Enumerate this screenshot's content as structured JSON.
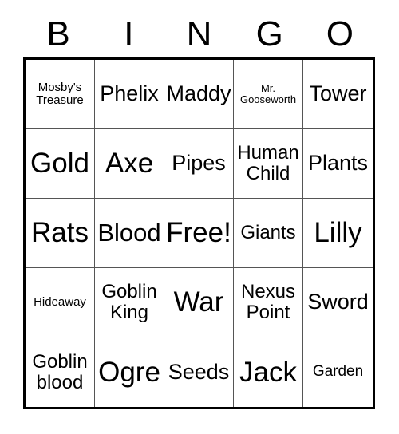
{
  "card": {
    "title": "BINGO",
    "header_letters": [
      "B",
      "I",
      "N",
      "G",
      "O"
    ],
    "free_space": "Free!",
    "colors": {
      "background": "#ffffff",
      "text": "#000000",
      "outer_border": "#000000",
      "grid_line": "#555555"
    },
    "grid": {
      "columns": 5,
      "rows": 5,
      "cells": [
        [
          {
            "label": "Mosby's Treasure",
            "size": "xs"
          },
          {
            "label": "Phelix",
            "size": "lg"
          },
          {
            "label": "Maddy",
            "size": "lg"
          },
          {
            "label": "Mr. Gooseworth",
            "size": "xxs"
          },
          {
            "label": "Tower",
            "size": "lg"
          }
        ],
        [
          {
            "label": "Gold",
            "size": "xxl"
          },
          {
            "label": "Axe",
            "size": "xxl"
          },
          {
            "label": "Pipes",
            "size": "lg"
          },
          {
            "label": "Human Child",
            "size": "md"
          },
          {
            "label": "Plants",
            "size": "lg"
          }
        ],
        [
          {
            "label": "Rats",
            "size": "xxl"
          },
          {
            "label": "Blood",
            "size": "xl"
          },
          {
            "label": "Free!",
            "size": "xxl"
          },
          {
            "label": "Giants",
            "size": "md"
          },
          {
            "label": "Lilly",
            "size": "xxl"
          }
        ],
        [
          {
            "label": "Hideaway",
            "size": "xs"
          },
          {
            "label": "Goblin King",
            "size": "md"
          },
          {
            "label": "War",
            "size": "xxl"
          },
          {
            "label": "Nexus Point",
            "size": "md"
          },
          {
            "label": "Sword",
            "size": "lg"
          }
        ],
        [
          {
            "label": "Goblin blood",
            "size": "md"
          },
          {
            "label": "Ogre",
            "size": "xxl"
          },
          {
            "label": "Seeds",
            "size": "lg"
          },
          {
            "label": "Jack",
            "size": "xxl"
          },
          {
            "label": "Garden",
            "size": "sm"
          }
        ]
      ]
    }
  }
}
